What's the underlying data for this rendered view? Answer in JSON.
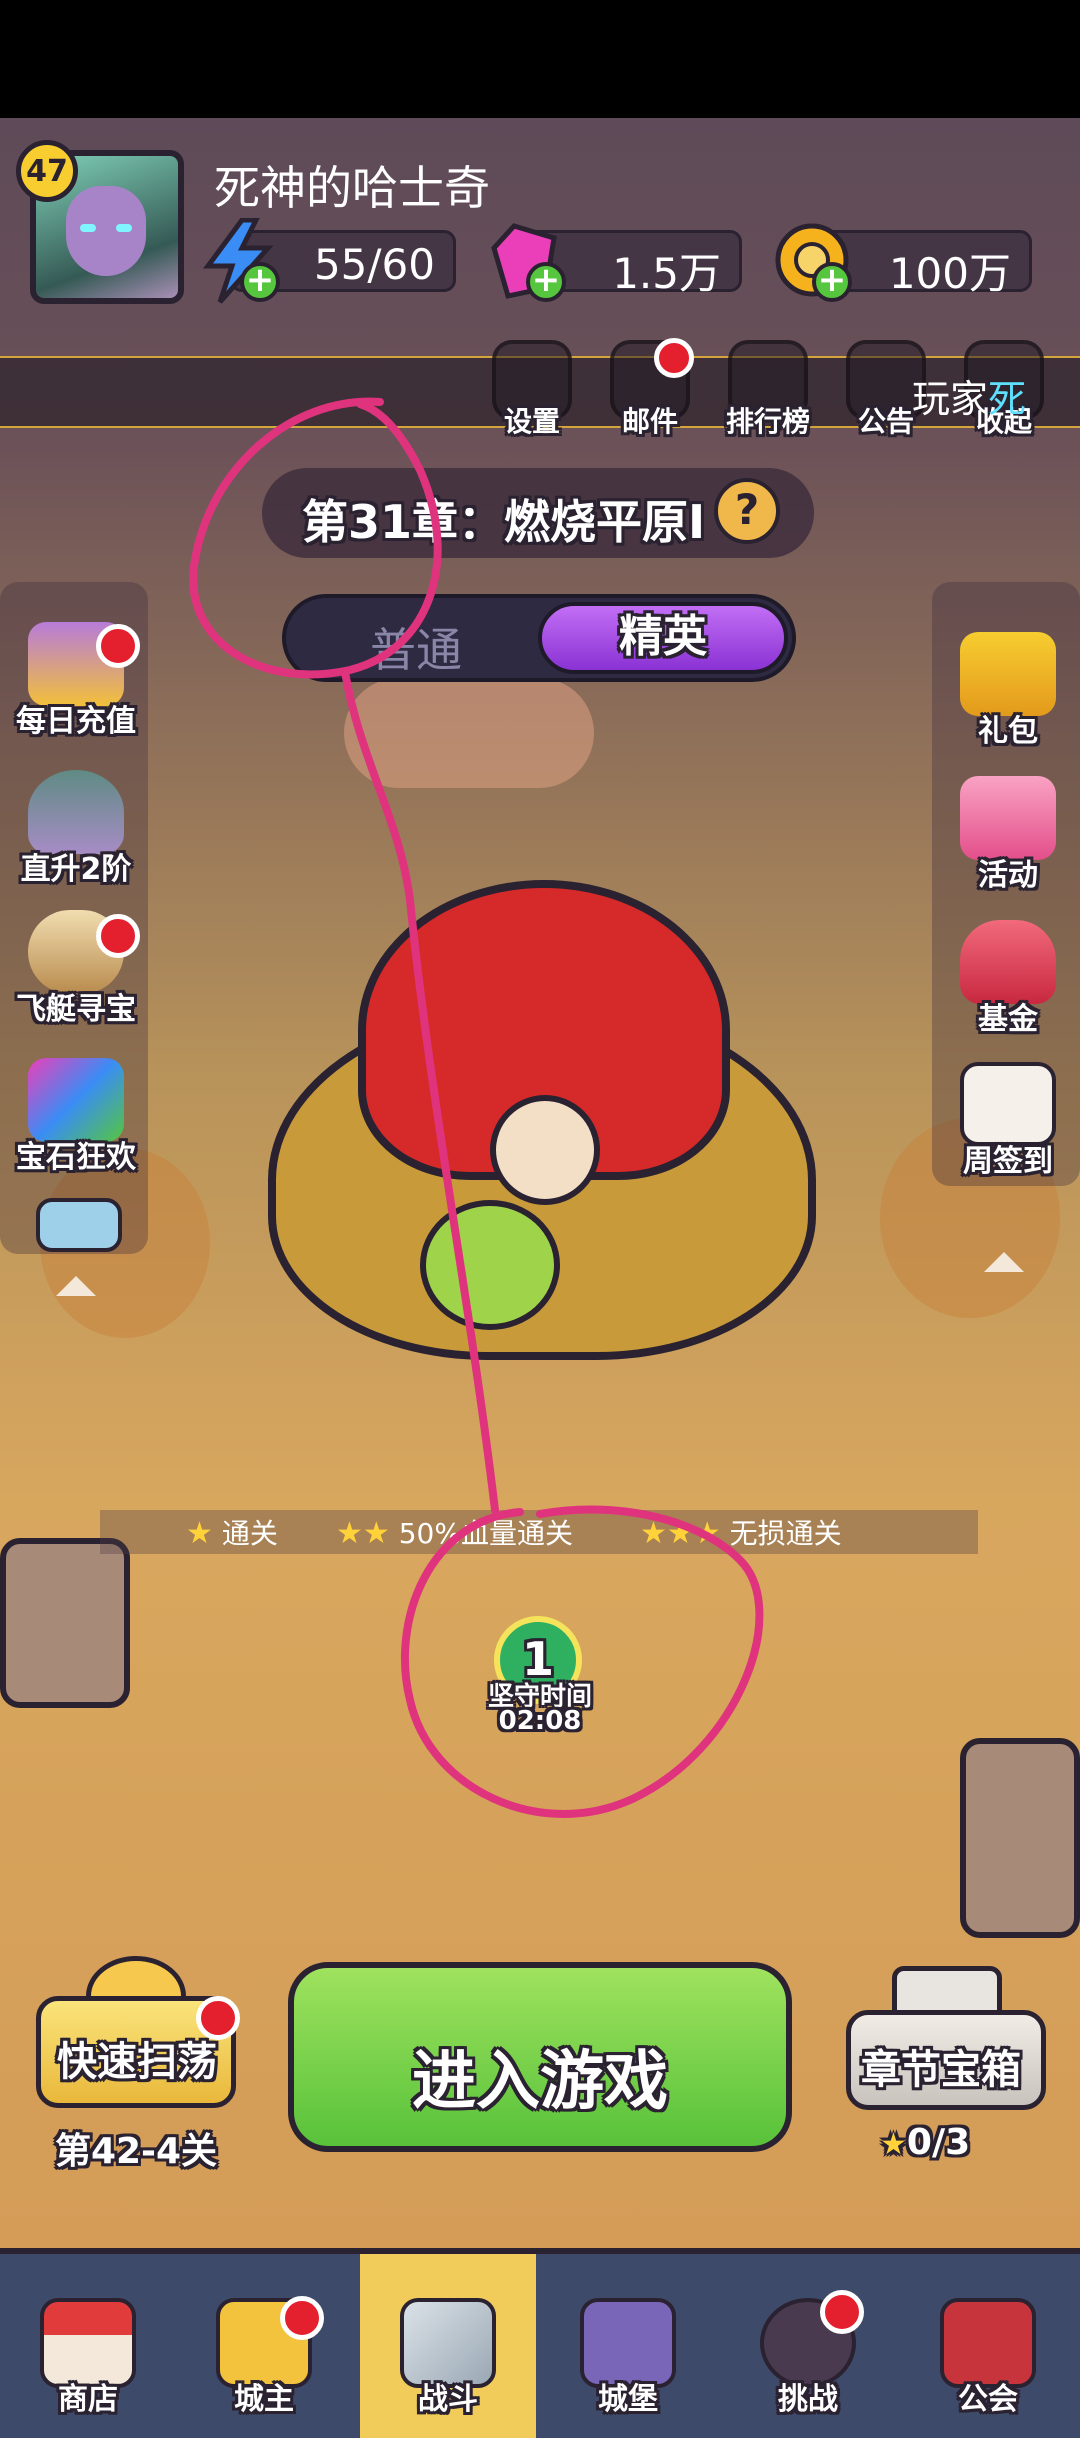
{
  "player": {
    "level": "47",
    "name": "死神的哈士奇"
  },
  "resources": {
    "stamina": "55/60",
    "gems": "1.5万",
    "gold": "100万"
  },
  "top_menu": {
    "settings": "设置",
    "mail": "邮件",
    "ranking": "排行榜",
    "notice": "公告",
    "collapse": "收起",
    "player_tag_prefix": "玩家",
    "player_tag_highlight": "死"
  },
  "chapter": {
    "title": "第31章：燃烧平原Ⅰ",
    "help": "?"
  },
  "mode": {
    "normal": "普通",
    "elite": "精英"
  },
  "left_panel": {
    "items": [
      {
        "label": "每日充值"
      },
      {
        "label": "直升2阶"
      },
      {
        "label": "飞艇寻宝"
      },
      {
        "label": "宝石狂欢"
      }
    ]
  },
  "right_panel": {
    "items": [
      {
        "label": "礼包"
      },
      {
        "label": "活动"
      },
      {
        "label": "基金"
      },
      {
        "label": "周签到"
      }
    ]
  },
  "conditions": {
    "c1": "通关",
    "c2": "50%血量通关",
    "c3": "无损通关"
  },
  "hold": {
    "number": "1",
    "label": "坚守时间",
    "time": "02:08"
  },
  "bottom": {
    "sweep": "快速扫荡",
    "sweep_stage": "第42-4关",
    "enter": "进入游戏",
    "chest": "章节宝箱",
    "chest_progress": "0/3"
  },
  "nav": {
    "items": [
      {
        "label": "商店"
      },
      {
        "label": "城主"
      },
      {
        "label": "战斗"
      },
      {
        "label": "城堡"
      },
      {
        "label": "挑战"
      },
      {
        "label": "公会"
      }
    ]
  },
  "colors": {
    "annotation": "#e0337e",
    "badge": "#e5202e",
    "accent_green": "#58c23a",
    "accent_purple": "#8a32d4"
  }
}
